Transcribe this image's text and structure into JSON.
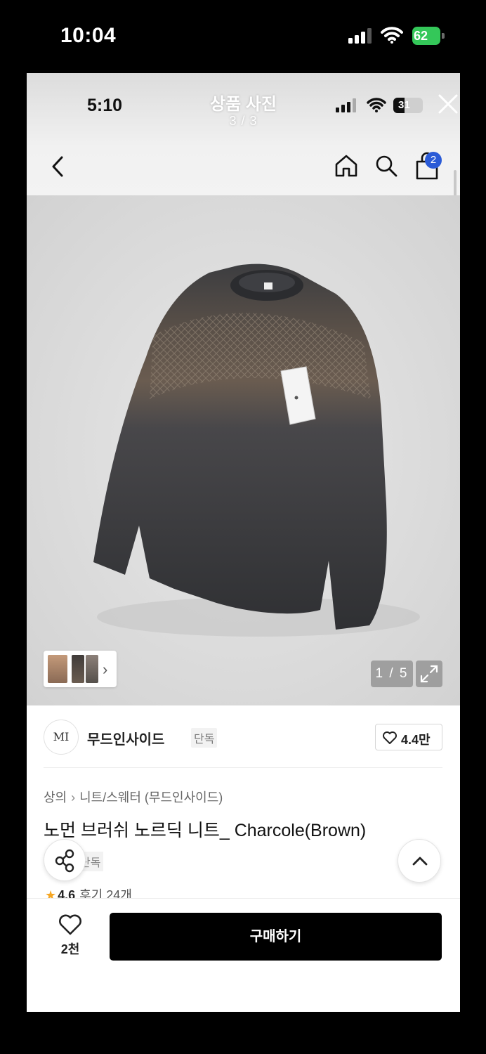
{
  "outer_status": {
    "time": "10:04",
    "battery": "62"
  },
  "viewer": {
    "inner_time": "5:10",
    "inner_battery": "31",
    "title": "상품 사진",
    "counter": "3 / 3"
  },
  "nav": {
    "cart_badge": "2"
  },
  "gallery": {
    "page_indicator": "1 / 5"
  },
  "brand": {
    "logo_text": "MI",
    "name": "무드인사이드",
    "tag": "단독",
    "likes": "4.4만"
  },
  "breadcrumb": {
    "category": "상의",
    "subcategory": "니트/스웨터 (무드인사이드)"
  },
  "product": {
    "title": "노먼 브러쉬 노르딕 니트_ Charcole(Brown)",
    "tag_partial": "단독"
  },
  "rating": {
    "score": "4.6",
    "reviews": "후기 24개"
  },
  "bottom": {
    "wish_count": "2천",
    "buy_label": "구매하기"
  },
  "colors": {
    "buy_button": "#000000",
    "cart_badge": "#2a5bd7",
    "star": "#f5a623",
    "battery_green": "#34c759"
  }
}
